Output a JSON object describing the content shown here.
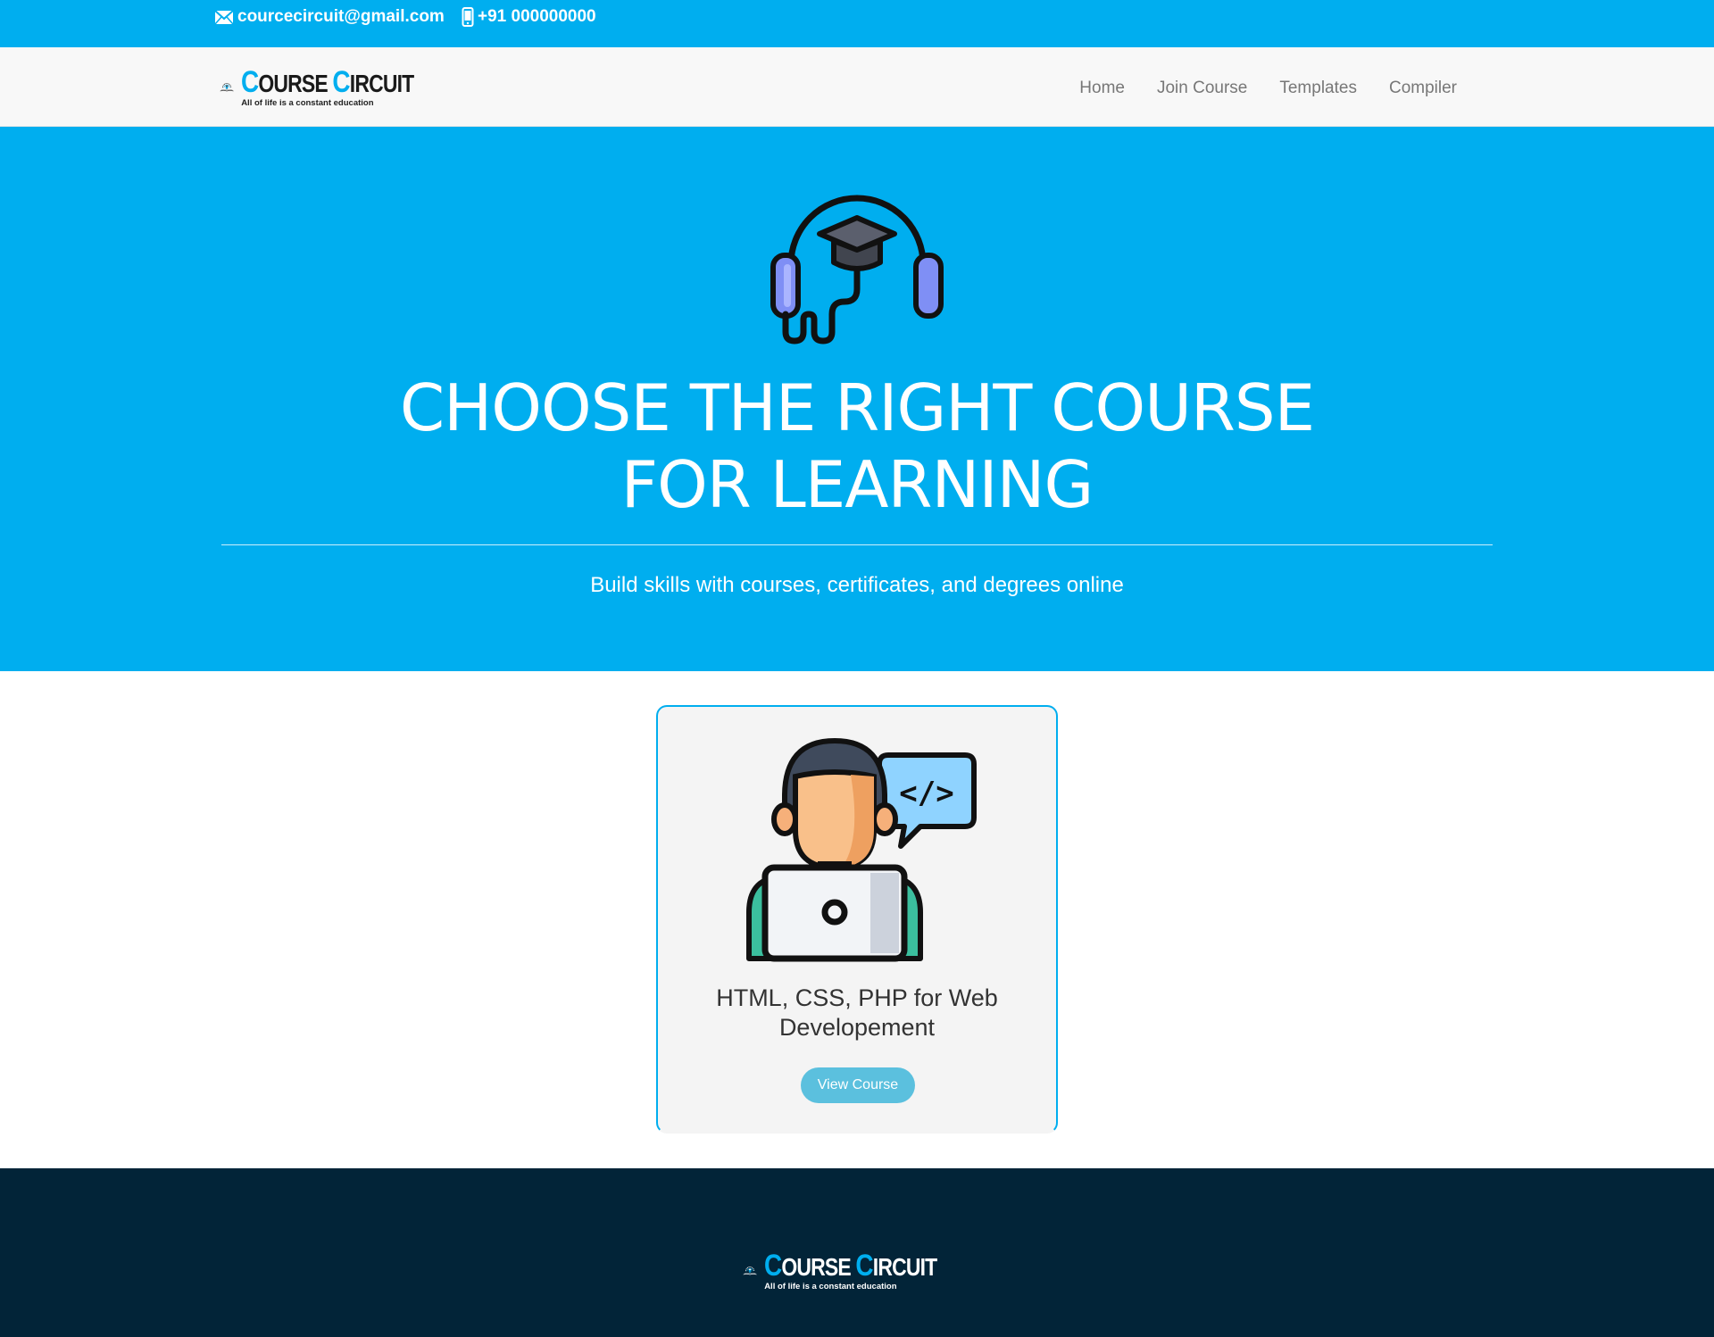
{
  "topbar": {
    "email": "courcecircuit@gmail.com",
    "phone": "+91 000000000",
    "email_icon": "envelope-icon",
    "phone_icon": "mobile-phone-icon"
  },
  "brand": {
    "first_cap": "C",
    "first_rest": "OURSE",
    "second_cap": "C",
    "second_rest": "IRCUIT",
    "tagline": "All of life is a constant education"
  },
  "nav": {
    "items": [
      {
        "label": "Home"
      },
      {
        "label": "Join Course"
      },
      {
        "label": "Templates"
      },
      {
        "label": "Compiler"
      }
    ]
  },
  "hero": {
    "icon": "headphones-graduation-cap-icon",
    "title_line1": "CHOOSE THE RIGHT COURSE",
    "title_line2": "FOR LEARNING",
    "subtitle": "Build skills with courses, certificates, and degrees online"
  },
  "courses": [
    {
      "image": "developer-with-laptop-icon",
      "title": "HTML, CSS, PHP for Web Developement",
      "button_label": "View Course"
    }
  ],
  "colors": {
    "primary": "#00aeef",
    "footer": "#022438",
    "button": "#5bc0de"
  }
}
